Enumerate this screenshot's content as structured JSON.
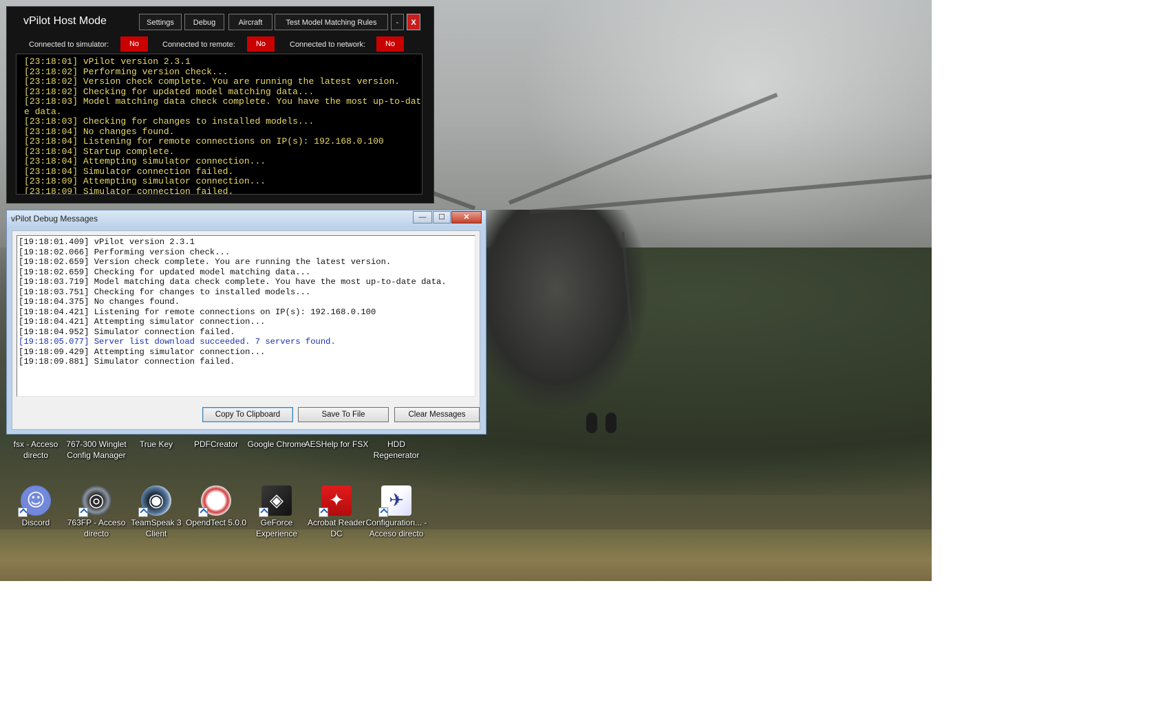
{
  "host_window": {
    "title": "vPilot Host Mode",
    "buttons": {
      "settings": "Settings",
      "debug": "Debug",
      "aircraft": "Aircraft",
      "test_model": "Test Model Matching Rules",
      "minimize": "-",
      "close": "X"
    },
    "status": [
      {
        "label": "Connected to simulator:",
        "value": "No"
      },
      {
        "label": "Connected to remote:",
        "value": "No"
      },
      {
        "label": "Connected to network:",
        "value": "No"
      }
    ],
    "console_lines": [
      "[23:18:01] vPilot version 2.3.1",
      "[23:18:02] Performing version check...",
      "[23:18:02] Version check complete. You are running the latest version.",
      "[23:18:02] Checking for updated model matching data...",
      "[23:18:03] Model matching data check complete. You have the most up-to-date data.",
      "[23:18:03] Checking for changes to installed models...",
      "[23:18:04] No changes found.",
      "[23:18:04] Listening for remote connections on IP(s): 192.168.0.100",
      "[23:18:04] Startup complete.",
      "[23:18:04] Attempting simulator connection...",
      "[23:18:04] Simulator connection failed.",
      "[23:18:09] Attempting simulator connection...",
      "[23:18:09] Simulator connection failed."
    ],
    "colors": {
      "background": "#141414",
      "console_text": "#e9d96a",
      "status_no": "#c90000"
    }
  },
  "debug_window": {
    "title": "vPilot Debug Messages",
    "window_buttons": {
      "minimize": "—",
      "maximize": "☐",
      "close": "✕"
    },
    "log_lines": [
      {
        "text": "[19:18:01.409] vPilot version 2.3.1",
        "color": "normal"
      },
      {
        "text": "[19:18:02.066] Performing version check...",
        "color": "normal"
      },
      {
        "text": "[19:18:02.659] Version check complete. You are running the latest version.",
        "color": "normal"
      },
      {
        "text": "[19:18:02.659] Checking for updated model matching data...",
        "color": "normal"
      },
      {
        "text": "[19:18:03.719] Model matching data check complete. You have the most up-to-date data.",
        "color": "normal"
      },
      {
        "text": "[19:18:03.751] Checking for changes to installed models...",
        "color": "normal"
      },
      {
        "text": "[19:18:04.375] No changes found.",
        "color": "normal"
      },
      {
        "text": "[19:18:04.421] Listening for remote connections on IP(s): 192.168.0.100",
        "color": "normal"
      },
      {
        "text": "[19:18:04.421] Attempting simulator connection...",
        "color": "normal"
      },
      {
        "text": "[19:18:04.952] Simulator connection failed.",
        "color": "normal"
      },
      {
        "text": "[19:18:05.077] Server list download succeeded. 7 servers found.",
        "color": "blue"
      },
      {
        "text": "[19:18:09.429] Attempting simulator connection...",
        "color": "normal"
      },
      {
        "text": "[19:18:09.881] Simulator connection failed.",
        "color": "normal"
      }
    ],
    "buttons": {
      "copy": "Copy To Clipboard",
      "save": "Save To File",
      "clear": "Clear Messages"
    }
  },
  "desktop": {
    "top_row_icons": [
      {
        "label": "fsx - Acceso directo"
      },
      {
        "label": "767-300 Winglet Config Manager"
      },
      {
        "label": "True Key"
      },
      {
        "label": "PDFCreator"
      },
      {
        "label": "Google Chrome"
      },
      {
        "label": "AESHelp for FSX"
      },
      {
        "label": "HDD Regenerator"
      }
    ],
    "bottom_row_icons": [
      {
        "label": "Discord",
        "icon": "discord-icon"
      },
      {
        "label": "763FP - Acceso directo",
        "icon": "763fp-icon"
      },
      {
        "label": "TeamSpeak 3 Client",
        "icon": "teamspeak-icon"
      },
      {
        "label": "OpendTect 5.0.0",
        "icon": "opendtect-icon"
      },
      {
        "label": "GeForce Experience",
        "icon": "geforce-icon"
      },
      {
        "label": "Acrobat Reader DC",
        "icon": "acrobat-icon"
      },
      {
        "label": "Configuration... - Acceso directo",
        "icon": "airplane-config-icon"
      }
    ]
  }
}
